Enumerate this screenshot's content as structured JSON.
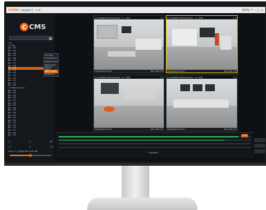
{
  "titlebar": {
    "app": "FSCMS",
    "tab": "Layout 1",
    "tab_controls": "+ ⟳",
    "right_items": [
      "100%",
      "?",
      "─",
      "□",
      "✕"
    ]
  },
  "sidebar": {
    "logo_letter": "C",
    "logo_text": "CMS",
    "search_placeholder": "",
    "tree": [
      "▸ My",
      "▾ All Site",
      "  ● 1 - 001",
      "  ● 1 - 002",
      "  ● 1 - 003",
      "  ● 1 - 004",
      "  ● 1 - 005",
      "  ● 1 - 006",
      "  ● 1 - 007",
      "  ● 1 - 008",
      "  ● 1 - 009",
      "  ● 1 - 010",
      "  ● 1 - 011",
      "  ● 1 - 012",
      "  ● 1 - 013",
      "  ● 1 - 014",
      "  ● 1 - 015",
      "  ● 1 - 016",
      "▾ CAMERA (Remote)",
      "  ● 2 - 001",
      "  ● 2 - 002",
      "  ● 2 - 003",
      "  ● 2 - 004",
      "  ● 2 - 005",
      "  ● 2 - 006",
      "  ● 2 - 007",
      "  ● 2 - 008",
      "  ● 2 - 009",
      "  ● 2 - 010",
      "  ● 2 - 011",
      "  ● 2 - 012",
      "  ● 2 - 013",
      "  ● 2 - 014",
      "  ● 2 - 015",
      "  ● 2 - 016",
      "  ● 2 - 017",
      "  ● 2 - 018",
      "  ● 2 - 019"
    ],
    "selected_index": 10,
    "context_menu": [
      "Live View",
      "Instant Search",
      "Playback Event",
      "Replay Event",
      "Playback Motion",
      "Motion Search",
      "Edit Device"
    ],
    "context_highlight": 5,
    "ctrl_row1": [
      "◁",
      "▷",
      "⇆"
    ],
    "ctrl_row2": [
      "◁",
      "▷",
      "⊟"
    ],
    "live_label": "Live",
    "live_value": "1 ×",
    "date": "1/4/2019",
    "time": "12:45 AM",
    "slider_level": 0.5
  },
  "cameras": [
    {
      "title": "[1-3] SMAX IP Plus Demo - 1 - CH1",
      "badge": "HD",
      "ts": "01/04/2019 12:45:47",
      "res": "IMV 1.0W  1 CH"
    },
    {
      "title": "[1-3] SMAX IP Plus Demo - 1 - CH2",
      "badge": "HD",
      "ts": "01/04/2019 12:45:47",
      "res": "IMV 1.0W  1 CH"
    },
    {
      "title": "[1-3] SMAX IP Plus Demo - 4 - CH3",
      "badge": "HD",
      "ts": "01/04/2019 12:45:47",
      "res": "IMV 1.0W  1 CH"
    },
    {
      "title": "[1-3] SMAX IP Plus Demo - 4 - CH4",
      "badge": "HD",
      "ts": "01/04/2019 12:45:47",
      "res": "IMV 1.0W  1 CH"
    }
  ],
  "timeline": {
    "date": "1/4/2019",
    "cursor_label": "12:45"
  }
}
